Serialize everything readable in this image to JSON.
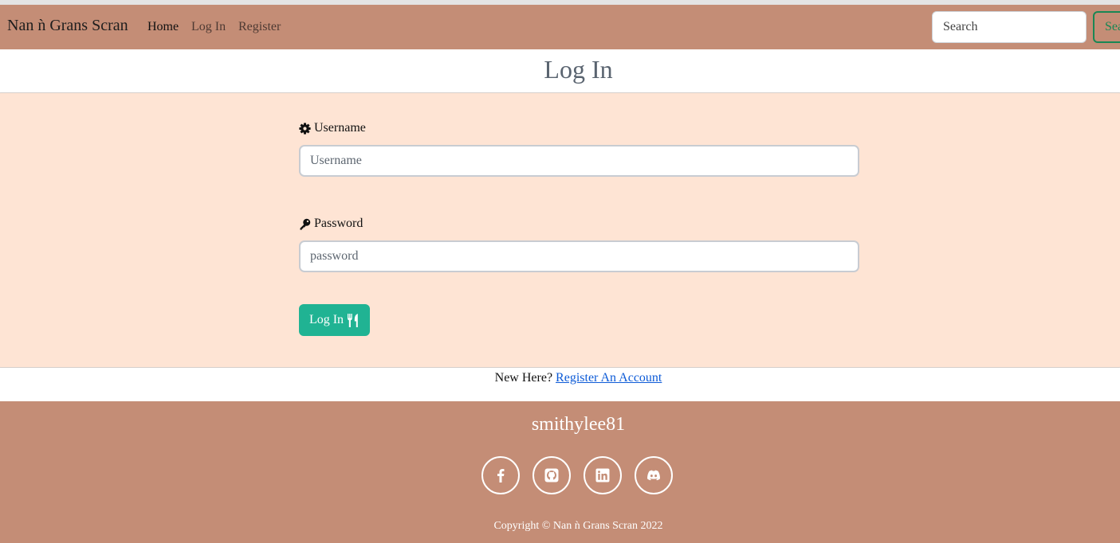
{
  "navbar": {
    "brand": "Nan ǹ Grans Scran",
    "links": [
      {
        "label": "Home",
        "active": true
      },
      {
        "label": "Log In",
        "active": false
      },
      {
        "label": "Register",
        "active": false
      }
    ],
    "search_placeholder": "Search",
    "search_button": "Search"
  },
  "main": {
    "title": "Log In",
    "username": {
      "label": "Username",
      "icon": "gear-icon",
      "placeholder": "Username"
    },
    "password": {
      "label": "Password",
      "icon": "key-icon",
      "placeholder": "password"
    },
    "submit_label": "Log In",
    "submit_icon": "utensils-icon",
    "register_prompt": "New Here?",
    "register_link": "Register An Account"
  },
  "footer": {
    "name": "smithylee81",
    "socials": [
      {
        "icon": "facebook-icon"
      },
      {
        "icon": "github-icon"
      },
      {
        "icon": "linkedin-icon"
      },
      {
        "icon": "discord-icon"
      }
    ],
    "copyright": "Copyright © Nan ǹ Grans Scran 2022"
  },
  "colors": {
    "brand": "#c48d76",
    "panel": "#fee4d4",
    "primary_button": "#20b393",
    "search_button": "#198754",
    "link": "#0d5bd7"
  }
}
